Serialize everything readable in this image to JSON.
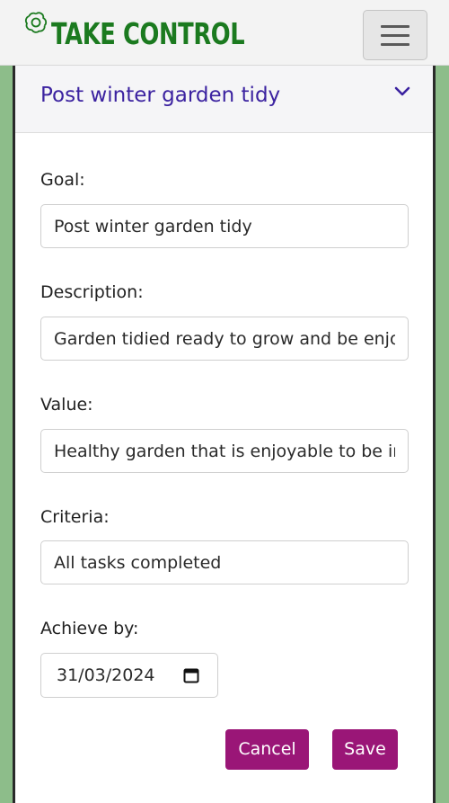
{
  "navbar": {
    "brand": "TAKE CONTROL",
    "brand_color": "#1b7a1f",
    "logo_icon": "openai-knot-icon",
    "menu_icon": "hamburger-icon"
  },
  "card": {
    "title": "Post winter garden tidy",
    "collapse_icon": "chevron-down-icon",
    "accent_color": "#3b22a0"
  },
  "form": {
    "goal": {
      "label": "Goal:",
      "value": "Post winter garden tidy"
    },
    "description": {
      "label": "Description:",
      "value": "Garden tidied ready to grow and be enjoyed"
    },
    "value": {
      "label": "Value:",
      "value": "Healthy garden that is enjoyable to be in"
    },
    "criteria": {
      "label": "Criteria:",
      "value": "All tasks completed"
    },
    "achieve_by": {
      "label": "Achieve by:",
      "value": "31/03/2024",
      "icon": "calendar-icon"
    }
  },
  "actions": {
    "cancel_label": "Cancel",
    "save_label": "Save",
    "button_color": "#9a1677"
  }
}
